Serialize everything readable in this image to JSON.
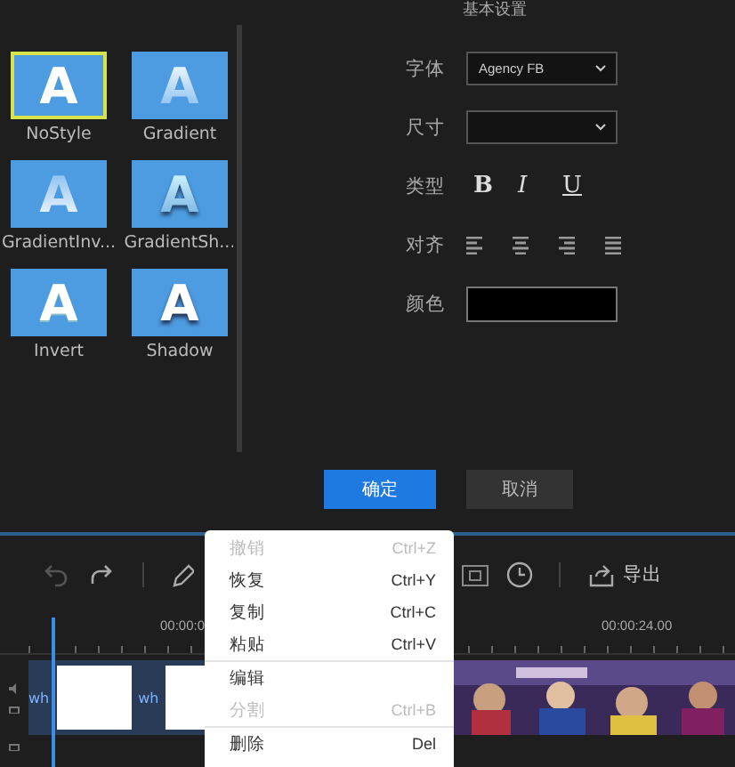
{
  "panel_heading": "基本设置",
  "styles": [
    {
      "label": "NoStyle",
      "glyph": "A",
      "kind": "plain",
      "selected": true
    },
    {
      "label": "Gradient",
      "glyph": "A",
      "kind": "gradient",
      "selected": false
    },
    {
      "label": "GradientInv...",
      "glyph": "A",
      "kind": "gradient_inverse",
      "selected": false
    },
    {
      "label": "GradientSh...",
      "glyph": "A",
      "kind": "gradient_shadow",
      "selected": false
    },
    {
      "label": "Invert",
      "glyph": "A",
      "kind": "invert",
      "selected": false
    },
    {
      "label": "Shadow",
      "glyph": "A",
      "kind": "shadow",
      "selected": false
    }
  ],
  "settings": {
    "font": {
      "label": "字体",
      "value": "Agency FB"
    },
    "size": {
      "label": "尺寸"
    },
    "type": {
      "label": "类型",
      "buttons": [
        {
          "text": "B",
          "kind": "bold"
        },
        {
          "text": "I",
          "kind": "italic"
        },
        {
          "text": "U",
          "kind": "underline"
        }
      ]
    },
    "align": {
      "label": "对齐",
      "options": [
        {
          "kind": "left"
        },
        {
          "kind": "center"
        },
        {
          "kind": "right"
        },
        {
          "kind": "justify"
        }
      ]
    },
    "color": {
      "label": "颜色",
      "color": "#000000"
    }
  },
  "actions": [
    {
      "label": "确定",
      "kind": "primary"
    },
    {
      "label": "取消",
      "kind": "secondary"
    }
  ],
  "toolbar": {
    "export_label": "导出"
  },
  "timeline": {
    "ticks": [
      "00:00:0",
      "00:00:24.00"
    ],
    "clips": [
      {
        "label": "wh"
      },
      {
        "label": "wh"
      }
    ]
  },
  "context_menu": [
    {
      "label": "撤销",
      "shortcut": "Ctrl+Z",
      "disabled": true,
      "divider_after": false
    },
    {
      "label": "恢复",
      "shortcut": "Ctrl+Y",
      "disabled": false,
      "divider_after": false
    },
    {
      "label": "复制",
      "shortcut": "Ctrl+C",
      "disabled": false,
      "divider_after": false
    },
    {
      "label": "粘贴",
      "shortcut": "Ctrl+V",
      "disabled": false,
      "divider_after": true
    },
    {
      "label": "编辑",
      "disabled": false,
      "divider_after": false
    },
    {
      "label": "分割",
      "shortcut": "Ctrl+B",
      "disabled": true,
      "divider_after": true
    },
    {
      "label": "删除",
      "shortcut": "Del",
      "disabled": false,
      "divider_after": false
    }
  ]
}
